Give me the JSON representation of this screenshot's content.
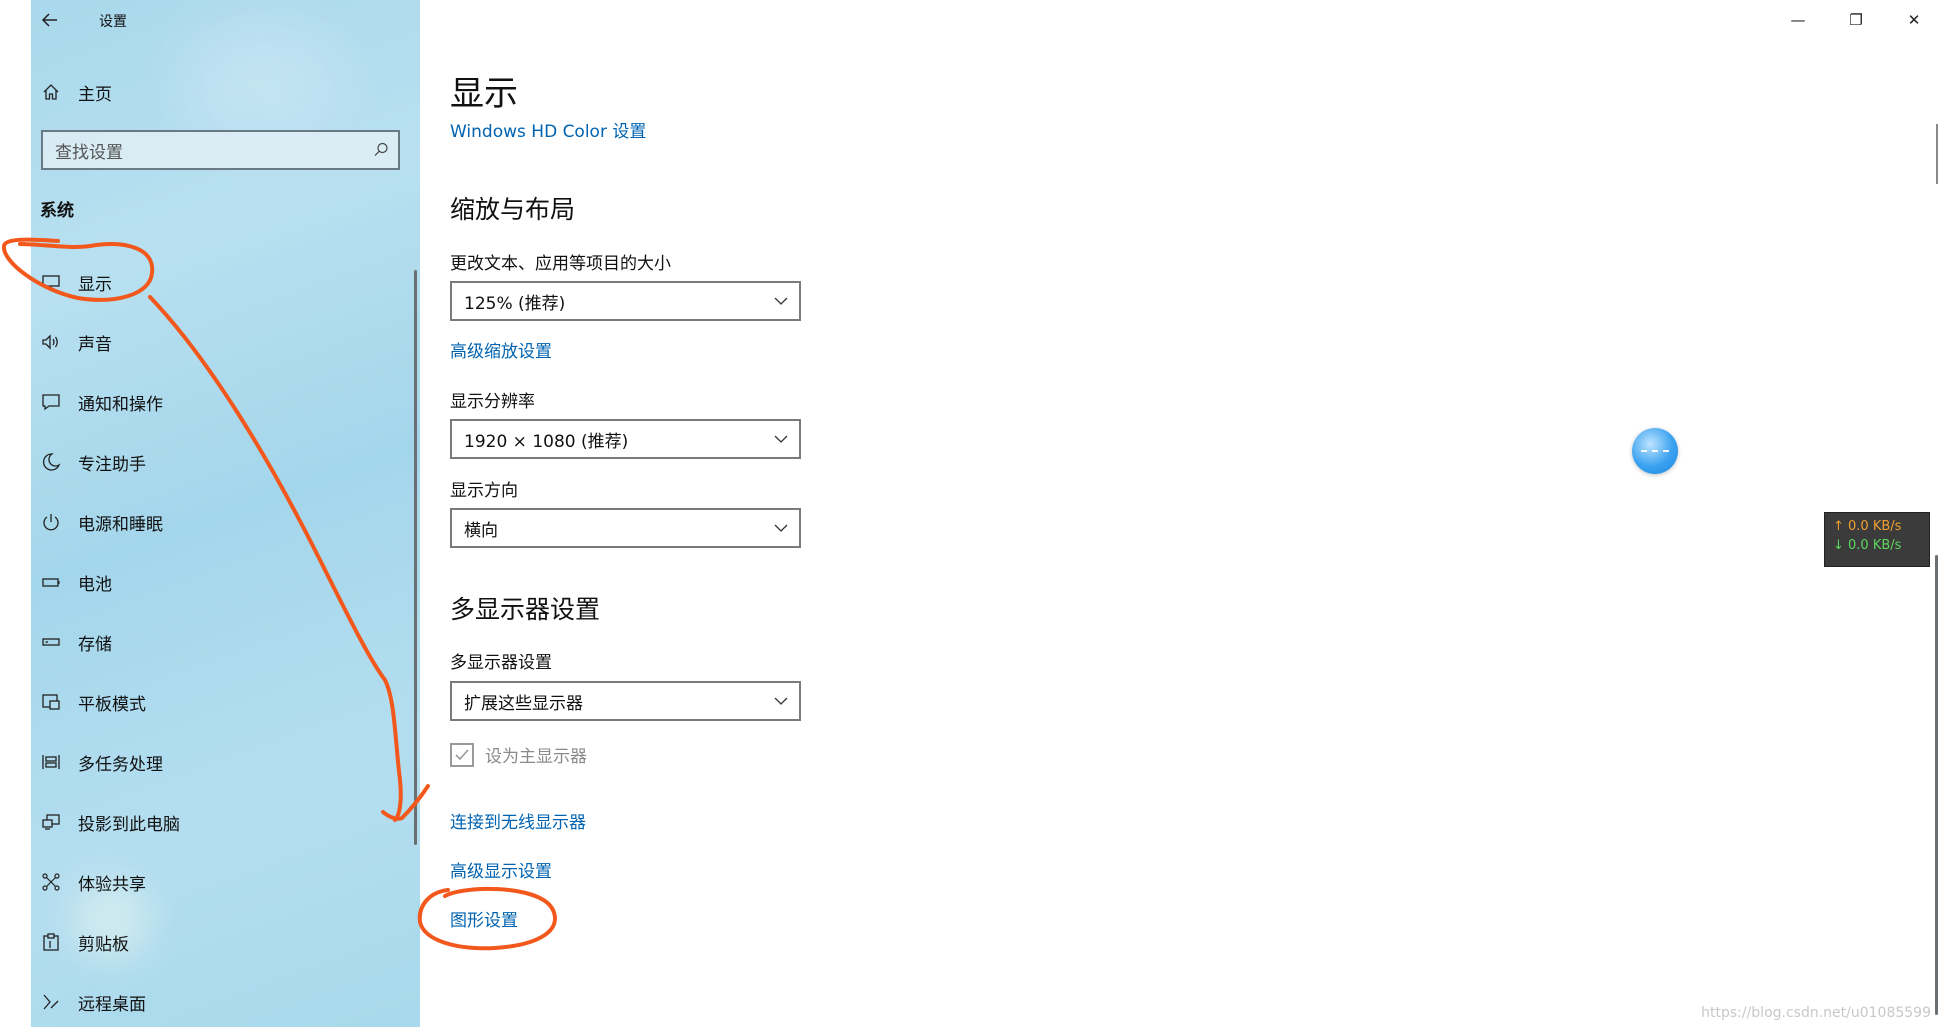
{
  "window": {
    "title": "设置",
    "controls": {
      "minimize": "—",
      "restore": "❐",
      "close": "✕"
    }
  },
  "sidebar": {
    "home_label": "主页",
    "search_placeholder": "查找设置",
    "section_label": "系统",
    "items": [
      {
        "label": "显示",
        "icon": "monitor-icon"
      },
      {
        "label": "声音",
        "icon": "speaker-icon"
      },
      {
        "label": "通知和操作",
        "icon": "notification-icon"
      },
      {
        "label": "专注助手",
        "icon": "moon-icon"
      },
      {
        "label": "电源和睡眠",
        "icon": "power-icon"
      },
      {
        "label": "电池",
        "icon": "battery-icon"
      },
      {
        "label": "存储",
        "icon": "storage-icon"
      },
      {
        "label": "平板模式",
        "icon": "tablet-icon"
      },
      {
        "label": "多任务处理",
        "icon": "multitask-icon"
      },
      {
        "label": "投影到此电脑",
        "icon": "project-icon"
      },
      {
        "label": "体验共享",
        "icon": "share-icon"
      },
      {
        "label": "剪贴板",
        "icon": "clipboard-icon"
      },
      {
        "label": "远程桌面",
        "icon": "remote-icon"
      }
    ]
  },
  "main": {
    "title": "显示",
    "hd_color_link": "Windows HD Color 设置",
    "scale_section": {
      "heading": "缩放与布局",
      "scale_label": "更改文本、应用等项目的大小",
      "scale_value": "125% (推荐)",
      "advanced_scale_link": "高级缩放设置",
      "resolution_label": "显示分辨率",
      "resolution_value": "1920 × 1080 (推荐)",
      "orientation_label": "显示方向",
      "orientation_value": "横向"
    },
    "multi_section": {
      "heading": "多显示器设置",
      "multi_label": "多显示器设置",
      "multi_value": "扩展这些显示器",
      "primary_checkbox_label": "设为主显示器",
      "primary_checked": true,
      "wireless_link": "连接到无线显示器",
      "advanced_display_link": "高级显示设置",
      "graphics_link": "图形设置"
    }
  },
  "overlay": {
    "net_up": "↑ 0.0 KB/s",
    "net_down": "↓ 0.0 KB/s",
    "watermark": "https://blog.csdn.net/u01085599"
  },
  "colors": {
    "link": "#0063b1",
    "annotation": "#f2581c",
    "sidebar_bg": "#a9d8ec"
  }
}
